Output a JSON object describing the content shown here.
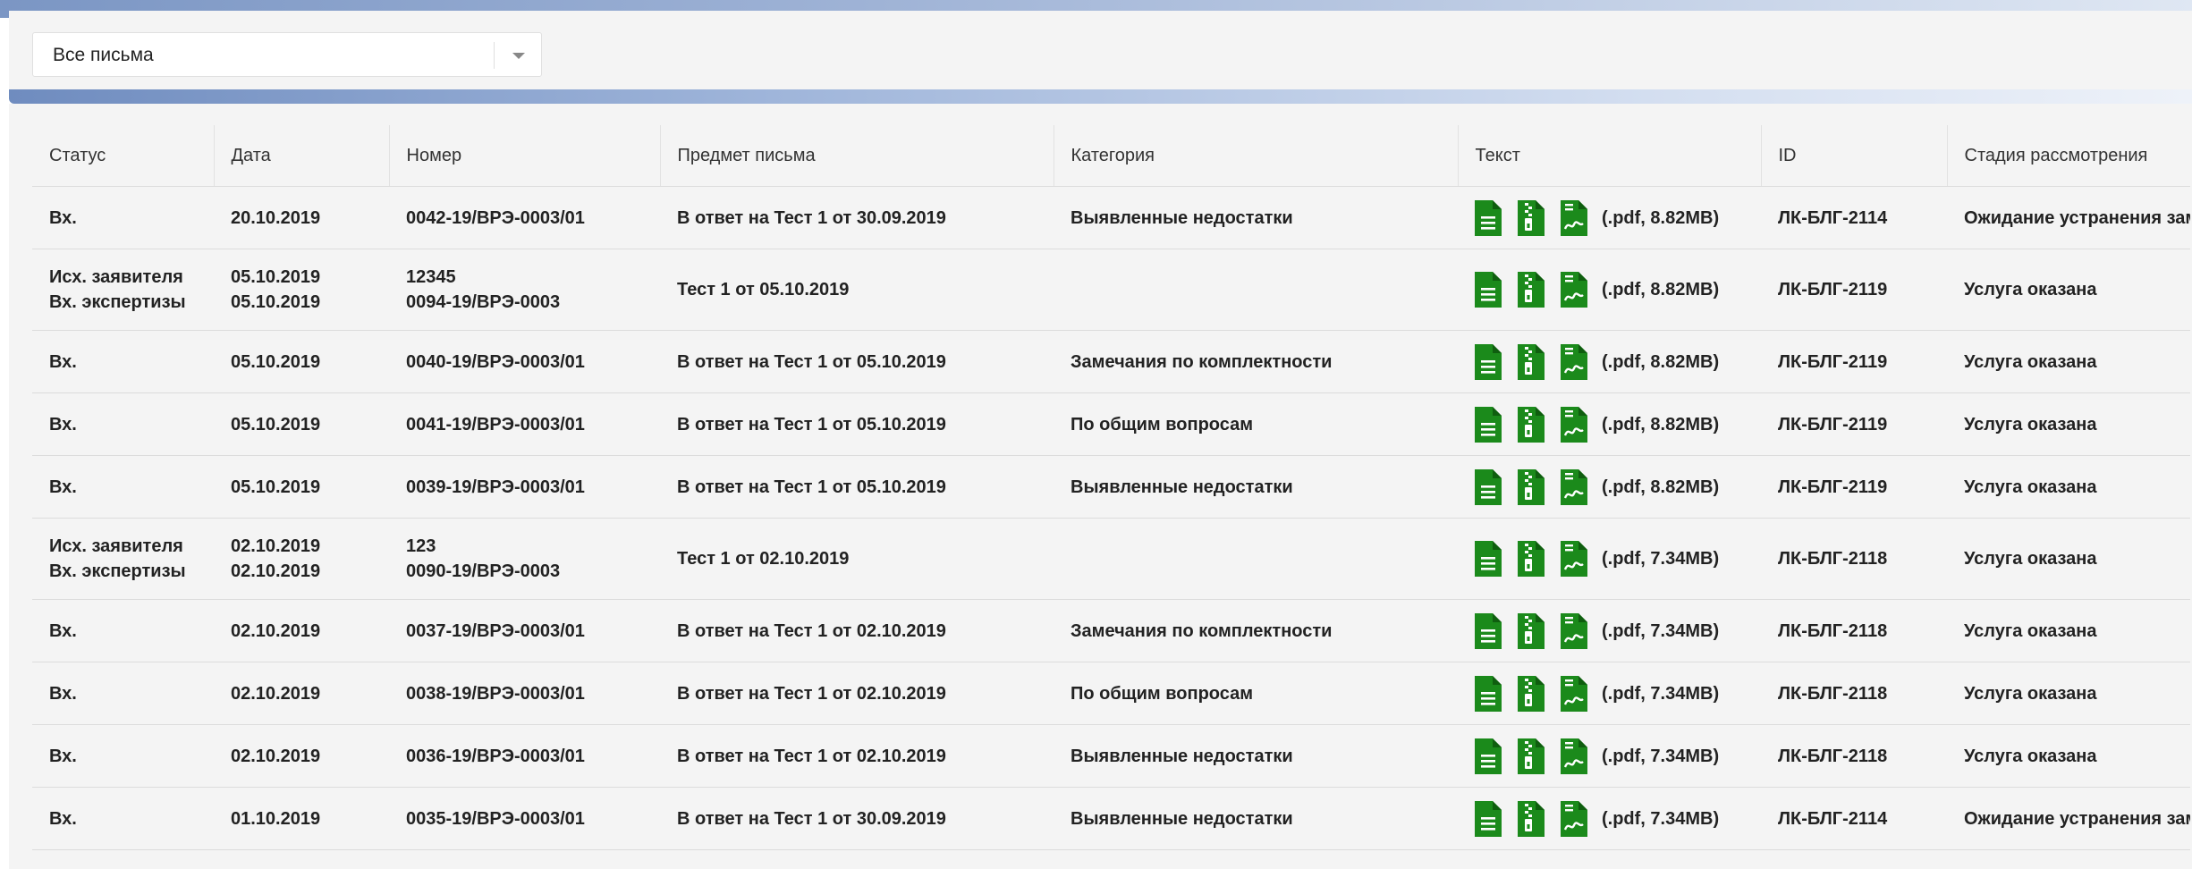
{
  "filter": {
    "selected": "Все письма"
  },
  "table": {
    "headers": [
      "Статус",
      "Дата",
      "Номер",
      "Предмет письма",
      "Категория",
      "Текст",
      "ID",
      "Стадия рассмотрения"
    ],
    "rows": [
      {
        "status": [
          "Вх."
        ],
        "date": [
          "20.10.2019"
        ],
        "number": [
          "0042-19/ВРЭ-0003/01"
        ],
        "subject": "В ответ на Тест 1 от 30.09.2019",
        "category": "Выявленные недостатки",
        "size": "(.pdf, 8.82MB)",
        "id": "ЛК-БЛГ-2114",
        "stage": "Ожидание устранения замечаний"
      },
      {
        "status": [
          "Исх. заявителя",
          "Вх. экспертизы"
        ],
        "date": [
          "05.10.2019",
          "05.10.2019"
        ],
        "number": [
          "12345",
          "0094-19/ВРЭ-0003"
        ],
        "subject": "Тест 1 от 05.10.2019",
        "category": "",
        "size": "(.pdf, 8.82MB)",
        "id": "ЛК-БЛГ-2119",
        "stage": "Услуга оказана"
      },
      {
        "status": [
          "Вх."
        ],
        "date": [
          "05.10.2019"
        ],
        "number": [
          "0040-19/ВРЭ-0003/01"
        ],
        "subject": "В ответ на Тест 1 от 05.10.2019",
        "category": "Замечания по комплектности",
        "size": "(.pdf, 8.82MB)",
        "id": "ЛК-БЛГ-2119",
        "stage": "Услуга оказана"
      },
      {
        "status": [
          "Вх."
        ],
        "date": [
          "05.10.2019"
        ],
        "number": [
          "0041-19/ВРЭ-0003/01"
        ],
        "subject": "В ответ на Тест 1 от 05.10.2019",
        "category": "По общим вопросам",
        "size": "(.pdf, 8.82MB)",
        "id": "ЛК-БЛГ-2119",
        "stage": "Услуга оказана"
      },
      {
        "status": [
          "Вх."
        ],
        "date": [
          "05.10.2019"
        ],
        "number": [
          "0039-19/ВРЭ-0003/01"
        ],
        "subject": "В ответ на Тест 1 от 05.10.2019",
        "category": "Выявленные недостатки",
        "size": "(.pdf, 8.82MB)",
        "id": "ЛК-БЛГ-2119",
        "stage": "Услуга оказана"
      },
      {
        "status": [
          "Исх. заявителя",
          "Вх. экспертизы"
        ],
        "date": [
          "02.10.2019",
          "02.10.2019"
        ],
        "number": [
          "123",
          "0090-19/ВРЭ-0003"
        ],
        "subject": "Тест 1 от 02.10.2019",
        "category": "",
        "size": "(.pdf, 7.34MB)",
        "id": "ЛК-БЛГ-2118",
        "stage": "Услуга оказана"
      },
      {
        "status": [
          "Вх."
        ],
        "date": [
          "02.10.2019"
        ],
        "number": [
          "0037-19/ВРЭ-0003/01"
        ],
        "subject": "В ответ на Тест 1 от 02.10.2019",
        "category": "Замечания по комплектности",
        "size": "(.pdf, 7.34MB)",
        "id": "ЛК-БЛГ-2118",
        "stage": "Услуга оказана"
      },
      {
        "status": [
          "Вх."
        ],
        "date": [
          "02.10.2019"
        ],
        "number": [
          "0038-19/ВРЭ-0003/01"
        ],
        "subject": "В ответ на Тест 1 от 02.10.2019",
        "category": "По общим вопросам",
        "size": "(.pdf, 7.34MB)",
        "id": "ЛК-БЛГ-2118",
        "stage": "Услуга оказана"
      },
      {
        "status": [
          "Вх."
        ],
        "date": [
          "02.10.2019"
        ],
        "number": [
          "0036-19/ВРЭ-0003/01"
        ],
        "subject": "В ответ на Тест 1 от 02.10.2019",
        "category": "Выявленные недостатки",
        "size": "(.pdf, 7.34MB)",
        "id": "ЛК-БЛГ-2118",
        "stage": "Услуга оказана"
      },
      {
        "status": [
          "Вх."
        ],
        "date": [
          "01.10.2019"
        ],
        "number": [
          "0035-19/ВРЭ-0003/01"
        ],
        "subject": "В ответ на Тест 1 от 30.09.2019",
        "category": "Выявленные недостатки",
        "size": "(.pdf, 7.34MB)",
        "id": "ЛК-БЛГ-2114",
        "stage": "Ожидание устранения замечаний"
      }
    ]
  },
  "icons": {
    "doc": "document-icon",
    "zip": "archive-icon",
    "sig": "signature-icon",
    "color": "#1b8a1b"
  }
}
